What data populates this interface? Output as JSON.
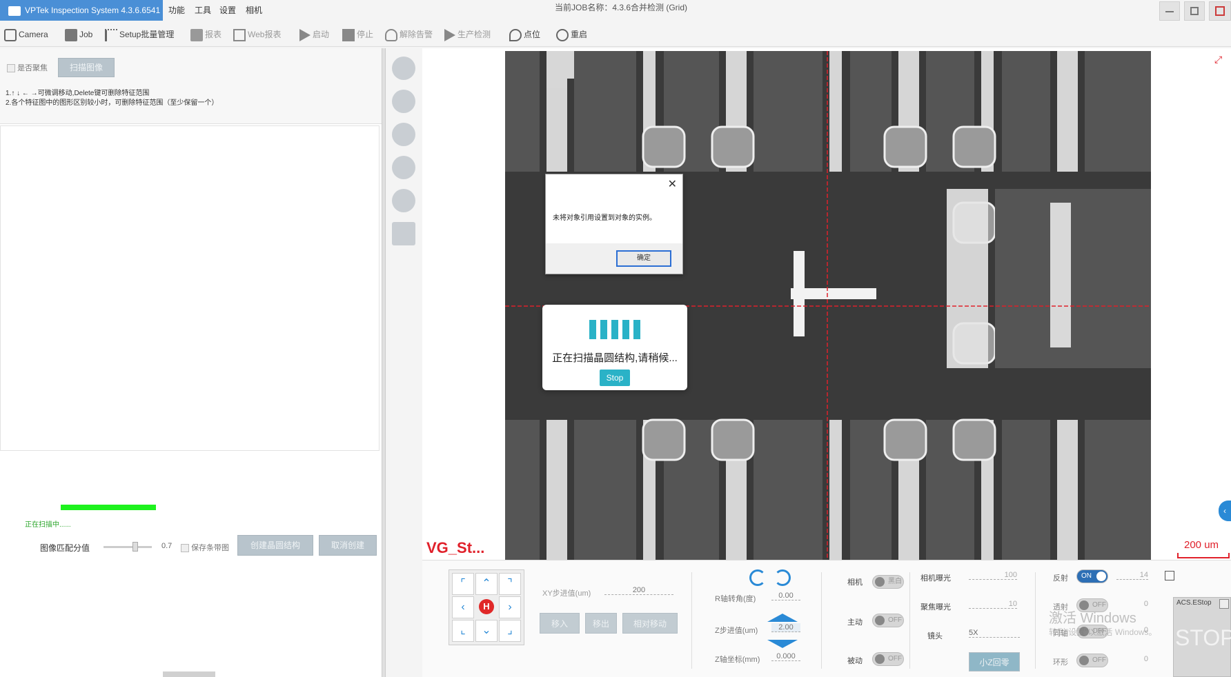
{
  "app": {
    "title": "VPTek Inspection System 4.3.6.6541",
    "menus": [
      "功能",
      "工具",
      "设置",
      "相机"
    ],
    "job_name": "当前JOB名称：4.3.6合并检测 (Grid)"
  },
  "toolbar": {
    "camera": "Camera",
    "job": "Job",
    "setup": "Setup批量管理",
    "report": "报表",
    "web_report": "Web报表",
    "start": "启动",
    "stop": "停止",
    "clear_alarm": "解除告警",
    "production": "生产检测",
    "point": "点位",
    "reset": "重启"
  },
  "left": {
    "autofocus_label": "是否聚焦",
    "scan_image_button": "扫描图像",
    "instruction_1": "1.↑ ↓ ← →可微调移动,Delete键可删除特征范围",
    "instruction_2": "2.各个特征图中的图形区别较小时，可删除特征范围（至少保留一个）",
    "scanning_status": "正在扫描中......",
    "progress": 1.0,
    "match_label": "图像匹配分值",
    "match_value": "0.7",
    "save_bg_label": "保存条带图",
    "create_button": "创建晶圆结构",
    "cancel_button": "取消创建"
  },
  "viewer": {
    "label": "VG_St...",
    "scale": "200 um"
  },
  "error_dialog": {
    "message": "未将对象引用设置到对象的实例。",
    "ok": "确定"
  },
  "scan_dialog": {
    "message": "正在扫描晶圆结构,请稍候...",
    "stop": "Stop"
  },
  "controls": {
    "home_label": "H",
    "xy_step_label": "XY步进值(um)",
    "xy_step_value": "200",
    "move_in": "移入",
    "move_out": "移出",
    "relative_move": "相对移动",
    "r_angle_label": "R轴转角(度)",
    "r_angle_value": "0.00",
    "z_step_label": "Z步进值(um)",
    "z_step_value": "2.00",
    "z_coord_label": "Z轴坐标(mm)",
    "z_coord_value": "0.000",
    "camera_label": "相机",
    "camera_toggle": "黑白",
    "active_label": "主动",
    "passive_label": "被动",
    "off": "OFF",
    "on": "ON",
    "cam_exposure_label": "相机曝光",
    "cam_exposure_value": "100",
    "focus_exposure_label": "聚焦曝光",
    "focus_exposure_value": "10",
    "lens_label": "镜头",
    "lens_value": "5X",
    "small_z_button": "小Z回零",
    "reflect_label": "反射",
    "reflect_value": "14",
    "transmit_label": "透射",
    "transmit_value": "0",
    "coax_label": "同轴",
    "coax_value": "0",
    "ring_label": "环形",
    "ring_value": "0",
    "watermark": "激活 Windows",
    "watermark_sub": "转到\"设置\"以激活 Windows。",
    "estop_label": "ACS.EStop",
    "estop_text": "STOP"
  },
  "colors": {
    "accent": "#4a8fd6",
    "progress": "#1ef21e",
    "crosshair": "#e0202a",
    "scan_accent": "#2ab2c7"
  }
}
